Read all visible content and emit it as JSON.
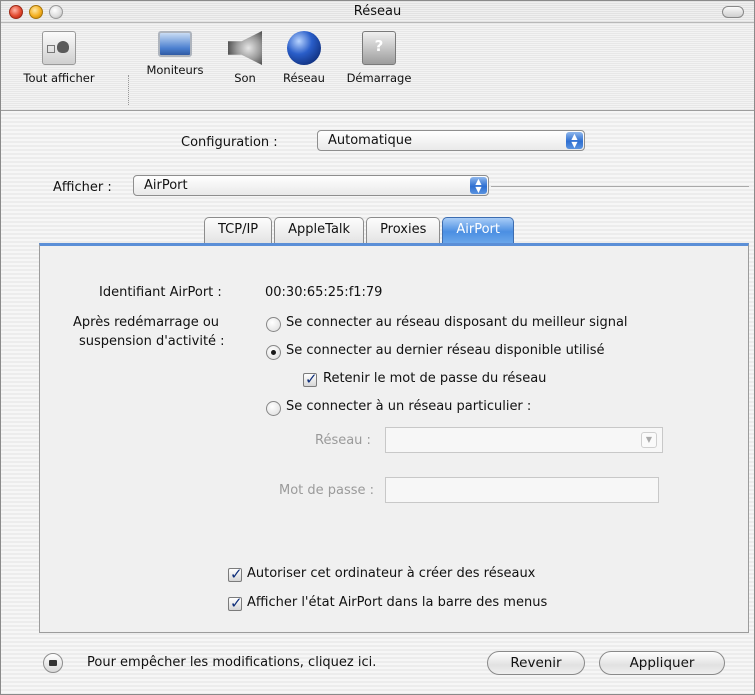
{
  "window": {
    "title": "Réseau"
  },
  "toolbar": {
    "items": [
      {
        "label": "Tout afficher",
        "icon": "show-all-icon"
      },
      {
        "label": "Moniteurs",
        "icon": "monitor-icon"
      },
      {
        "label": "Son",
        "icon": "speaker-icon"
      },
      {
        "label": "Réseau",
        "icon": "globe-icon"
      },
      {
        "label": "Démarrage",
        "icon": "startup-disk-icon"
      }
    ]
  },
  "configuration": {
    "label": "Configuration :",
    "value": "Automatique"
  },
  "afficher": {
    "label": "Afficher :",
    "value": "AirPort"
  },
  "tabs": [
    {
      "label": "TCP/IP",
      "active": false
    },
    {
      "label": "AppleTalk",
      "active": false
    },
    {
      "label": "Proxies",
      "active": false
    },
    {
      "label": "AirPort",
      "active": true
    }
  ],
  "airport": {
    "id_label": "Identifiant AirPort :",
    "id_value": "00:30:65:25:f1:79",
    "after_label_line1": "Après redémarrage ou",
    "after_label_line2": "suspension d'activité :",
    "options": [
      {
        "label": "Se connecter au réseau disposant du meilleur signal",
        "selected": false
      },
      {
        "label": "Se connecter au dernier réseau disponible utilisé",
        "selected": true
      },
      {
        "label": "Se connecter à un réseau particulier :",
        "selected": false
      }
    ],
    "remember_password": {
      "label": "Retenir le mot de passe du réseau",
      "checked": true
    },
    "network_label": "Réseau :",
    "network_value": "",
    "password_label": "Mot de passe :",
    "password_value": "",
    "allow_create": {
      "label": "Autoriser cet ordinateur à créer des réseaux",
      "checked": true
    },
    "show_status": {
      "label": "Afficher l'état AirPort dans la barre des menus",
      "checked": true
    }
  },
  "footer": {
    "lock_text": "Pour empêcher les modifications, cliquez ici.",
    "revert_label": "Revenir",
    "apply_label": "Appliquer"
  },
  "colors": {
    "accent": "#4b8fe2",
    "tab_active_text": "#ffffff"
  }
}
